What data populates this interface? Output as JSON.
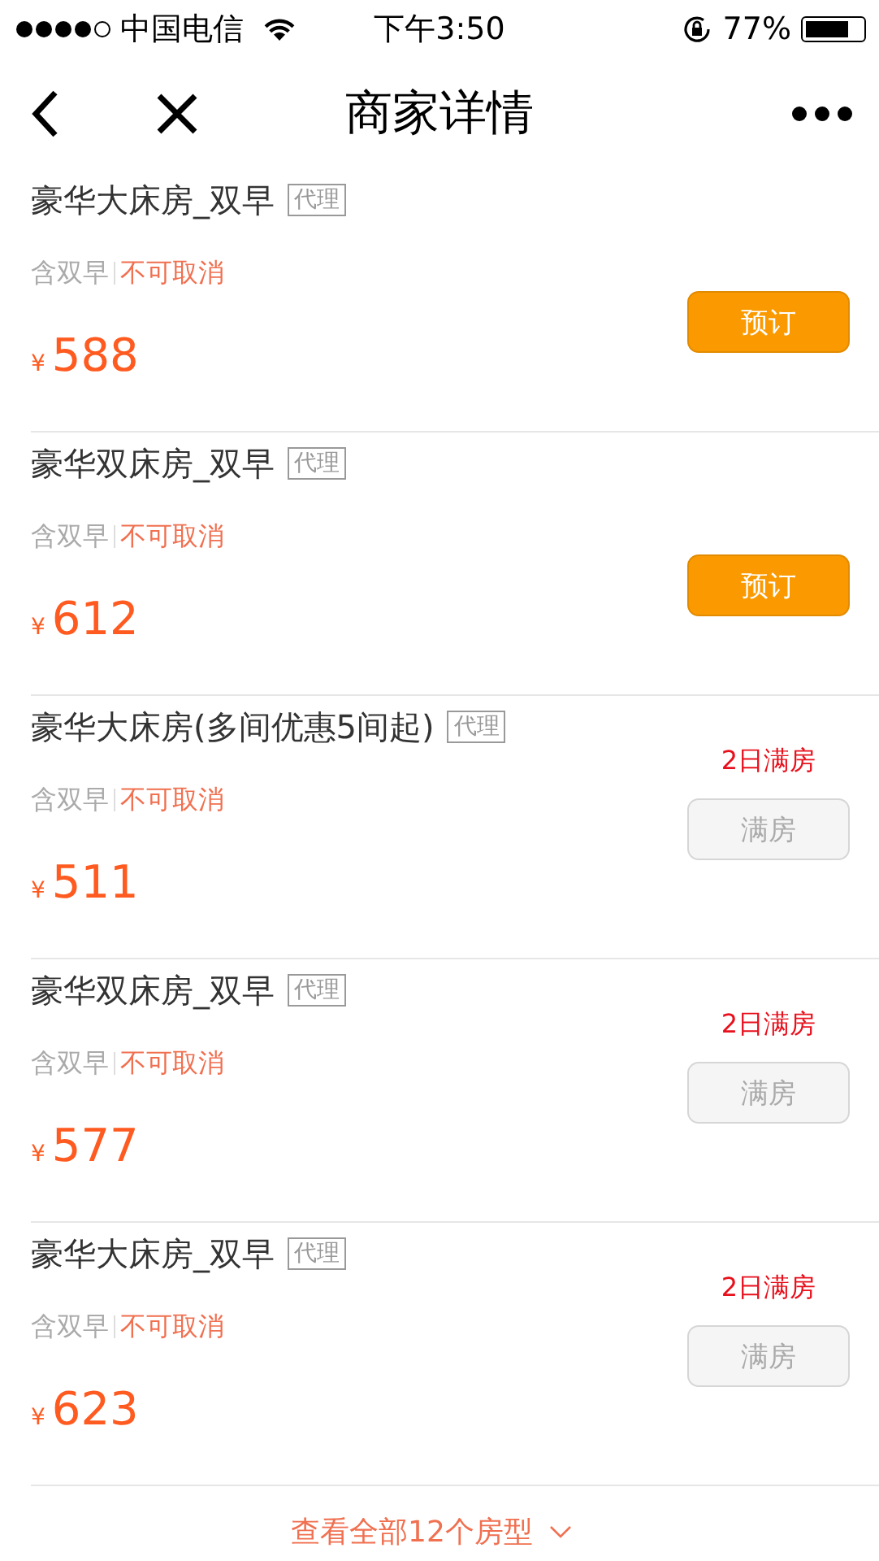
{
  "status_bar": {
    "carrier": "中国电信",
    "time": "下午3:50",
    "battery": "77%"
  },
  "nav": {
    "title": "商家详情"
  },
  "rooms": [
    {
      "name": "豪华大床房_双早",
      "tag": "代理",
      "breakfast": "含双早",
      "policy": "不可取消",
      "currency": "¥",
      "price": "588",
      "kind": "available",
      "button": "预订"
    },
    {
      "name": "豪华双床房_双早",
      "tag": "代理",
      "breakfast": "含双早",
      "policy": "不可取消",
      "currency": "¥",
      "price": "612",
      "kind": "available",
      "button": "预订"
    },
    {
      "name": "豪华大床房(多间优惠5间起)",
      "tag": "代理",
      "breakfast": "含双早",
      "policy": "不可取消",
      "currency": "¥",
      "price": "511",
      "kind": "full",
      "note": "2日满房",
      "button": "满房"
    },
    {
      "name": "豪华双床房_双早",
      "tag": "代理",
      "breakfast": "含双早",
      "policy": "不可取消",
      "currency": "¥",
      "price": "577",
      "kind": "full",
      "note": "2日满房",
      "button": "满房"
    },
    {
      "name": "豪华大床房_双早",
      "tag": "代理",
      "breakfast": "含双早",
      "policy": "不可取消",
      "currency": "¥",
      "price": "623",
      "kind": "full",
      "note": "2日满房",
      "button": "满房"
    }
  ],
  "more": {
    "label": "查看全部12个房型"
  }
}
